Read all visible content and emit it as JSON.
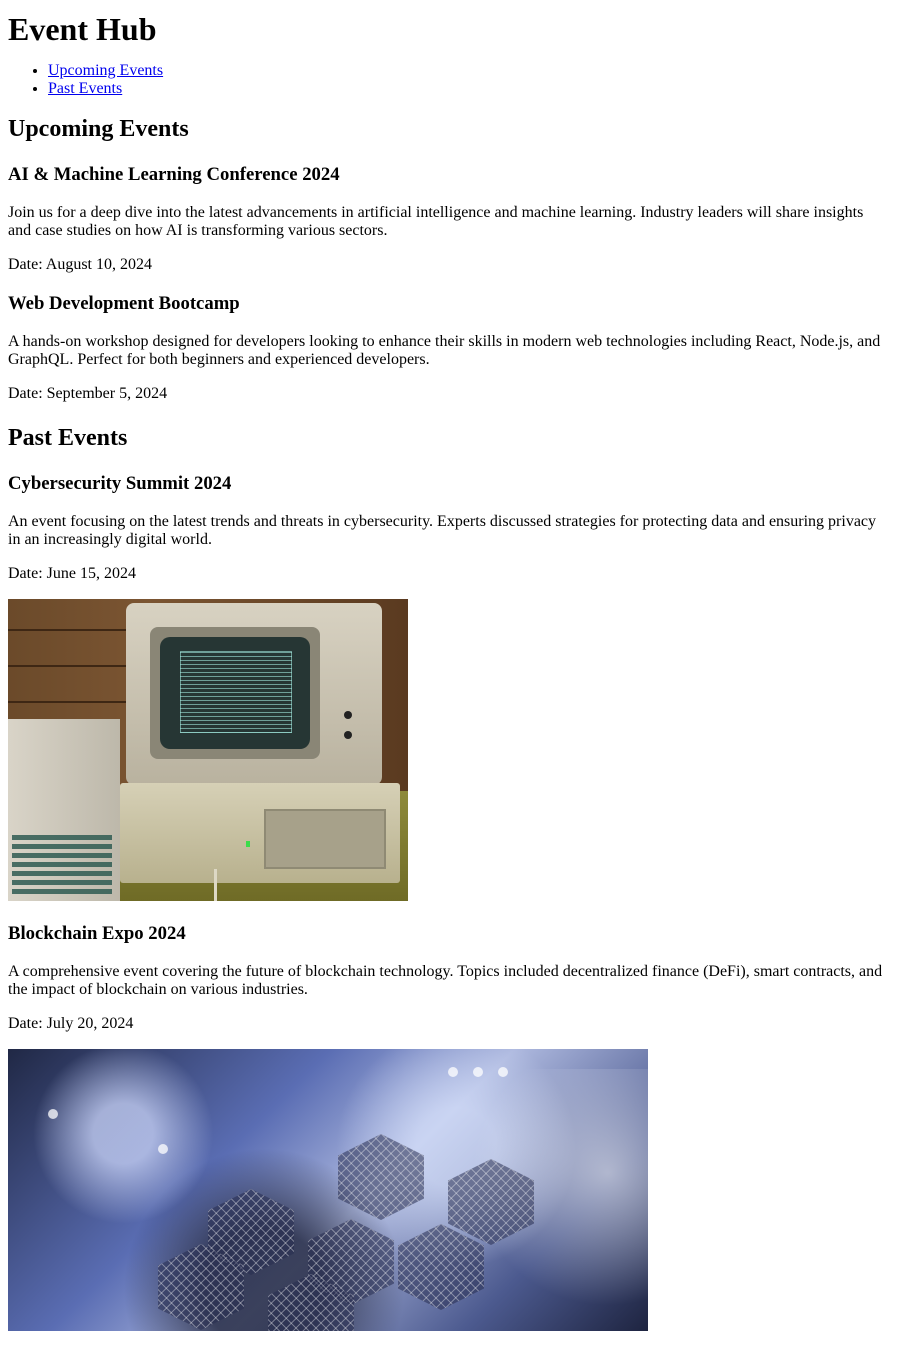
{
  "site": {
    "title": "Event Hub"
  },
  "nav": {
    "items": [
      {
        "label": "Upcoming Events"
      },
      {
        "label": "Past Events"
      }
    ]
  },
  "upcoming": {
    "heading": "Upcoming Events",
    "events": [
      {
        "title": "AI & Machine Learning Conference 2024",
        "description": "Join us for a deep dive into the latest advancements in artificial intelligence and machine learning. Industry leaders will share insights and case studies on how AI is transforming various sectors.",
        "date": "Date: August 10, 2024"
      },
      {
        "title": "Web Development Bootcamp",
        "description": "A hands-on workshop designed for developers looking to enhance their skills in modern web technologies including React, Node.js, and GraphQL. Perfect for both beginners and experienced developers.",
        "date": "Date: September 5, 2024"
      }
    ]
  },
  "past": {
    "heading": "Past Events",
    "events": [
      {
        "title": "Cybersecurity Summit 2024",
        "description": "An event focusing on the latest trends and threats in cybersecurity. Experts discussed strategies for protecting data and ensuring privacy in an increasingly digital world.",
        "date": "Date: June 15, 2024",
        "image_icon": "vintage-computer-photo"
      },
      {
        "title": "Blockchain Expo 2024",
        "description": "A comprehensive event covering the future of blockchain technology. Topics included decentralized finance (DeFi), smart contracts, and the impact of blockchain on various industries.",
        "date": "Date: July 20, 2024",
        "image_icon": "blockchain-network-illustration"
      }
    ]
  },
  "colors": {
    "link": "#0000ee",
    "text": "#000000",
    "background": "#ffffff"
  }
}
